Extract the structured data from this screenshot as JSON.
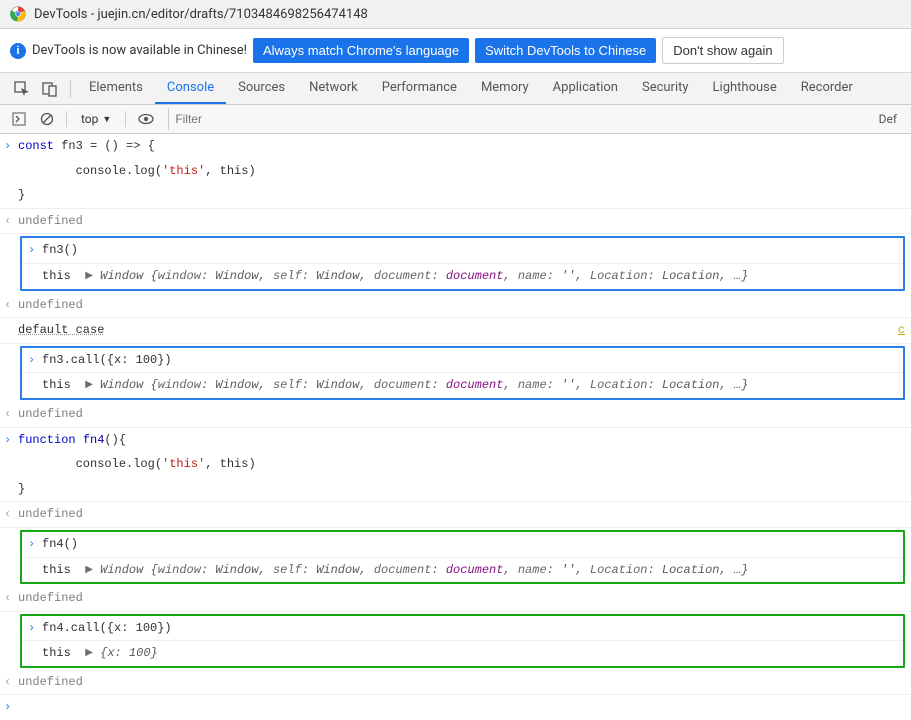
{
  "window": {
    "title": "DevTools - juejin.cn/editor/drafts/7103484698256474148"
  },
  "infobar": {
    "text": "DevTools is now available in Chinese!",
    "btn_match": "Always match Chrome's language",
    "btn_switch": "Switch DevTools to Chinese",
    "btn_dismiss": "Don't show again"
  },
  "tabs": {
    "elements": "Elements",
    "console": "Console",
    "sources": "Sources",
    "network": "Network",
    "performance": "Performance",
    "memory": "Memory",
    "application": "Application",
    "security": "Security",
    "lighthouse": "Lighthouse",
    "recorder": "Recorder"
  },
  "subbar": {
    "context": "top",
    "filter_placeholder": "Filter",
    "default_levels": "Def"
  },
  "console": {
    "line1": "const fn3 = () => {",
    "line1b": "        console.log('this', this)",
    "line1c": "}",
    "undef": "undefined",
    "call_fn3": "fn3()",
    "this_label": "this",
    "win_preview_head": "Window ",
    "win_preview_body": "{window: Window, self: Window, document: document, name: '', Location: Location, …}",
    "default_case": "default case",
    "call_fn3_call": "fn3.call({x: 100})",
    "fn4_def1": "function fn4(){",
    "fn4_def2": "        console.log('this', this)",
    "fn4_def3": "}",
    "call_fn4": "fn4()",
    "call_fn4_call": "fn4.call({x: 100})",
    "obj_x100": "{x: 100}"
  }
}
